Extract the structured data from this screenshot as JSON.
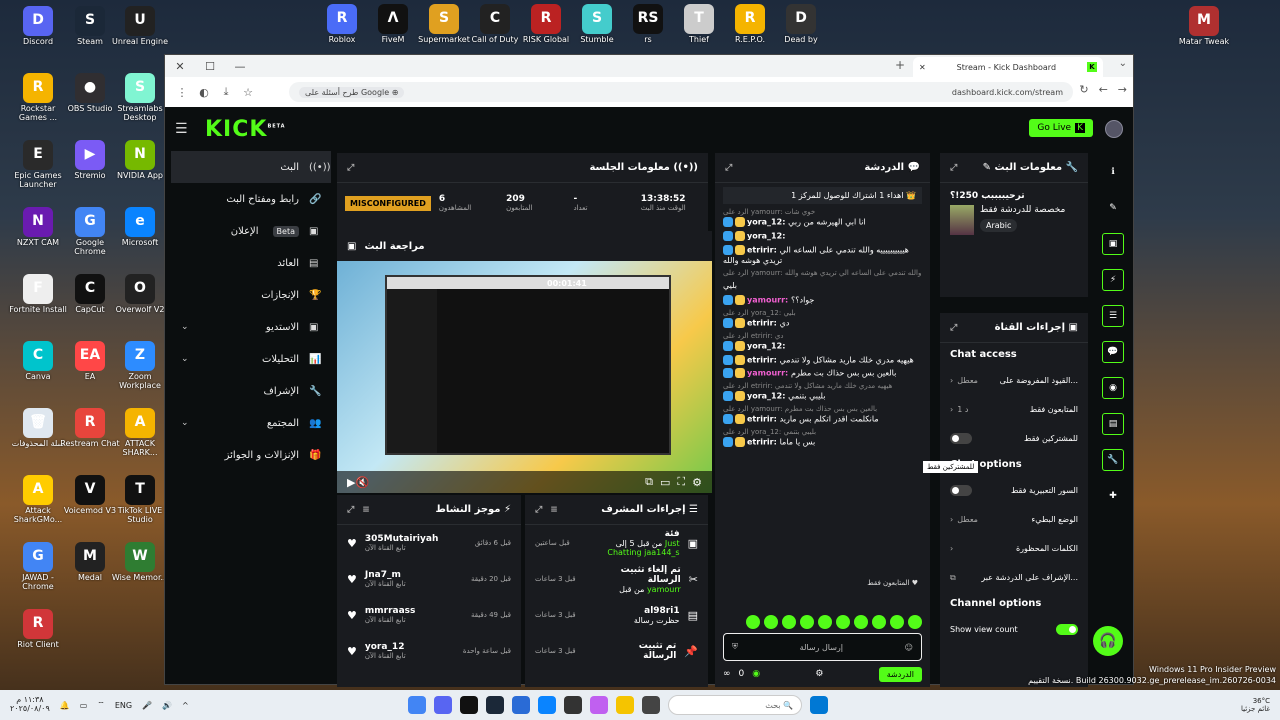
{
  "desktop_icons_left": [
    {
      "label": "Discord",
      "color": "#5865F2",
      "glyph": "D"
    },
    {
      "label": "Steam",
      "color": "#1b2838",
      "glyph": "S"
    },
    {
      "label": "Unreal Engine",
      "color": "#222",
      "glyph": "U"
    },
    {
      "label": "Rockstar Games ...",
      "color": "#f5b400",
      "glyph": "R"
    },
    {
      "label": "OBS Studio",
      "color": "#302e31",
      "glyph": "●"
    },
    {
      "label": "Streamlabs Desktop",
      "color": "#80f5d2",
      "glyph": "S"
    },
    {
      "label": "Epic Games Launcher",
      "color": "#2a2a2a",
      "glyph": "E"
    },
    {
      "label": "Stremio",
      "color": "#7b5bf5",
      "glyph": "▶"
    },
    {
      "label": "NVIDIA App",
      "color": "#76b900",
      "glyph": "N"
    },
    {
      "label": "NZXT CAM",
      "color": "#6a1bb0",
      "glyph": "N"
    },
    {
      "label": "Google Chrome",
      "color": "#4285f4",
      "glyph": "G"
    },
    {
      "label": "Microsoft",
      "color": "#0a84ff",
      "glyph": "e"
    },
    {
      "label": "Fortnite Install",
      "color": "#eee",
      "glyph": "F"
    },
    {
      "label": "CapCut",
      "color": "#111",
      "glyph": "C"
    },
    {
      "label": "Overwolf V2",
      "color": "#222",
      "glyph": "O"
    },
    {
      "label": "Canva",
      "color": "#00c4cc",
      "glyph": "C"
    },
    {
      "label": "EA",
      "color": "#ff4747",
      "glyph": "EA"
    },
    {
      "label": "Zoom Workplace",
      "color": "#2d8cff",
      "glyph": "Z"
    },
    {
      "label": "سلة المحذوفات",
      "color": "#dfe7ef",
      "glyph": "🗑"
    },
    {
      "label": "Restream Chat",
      "color": "#e8453c",
      "glyph": "R"
    },
    {
      "label": "ATTACK SHARK...",
      "color": "#f5b400",
      "glyph": "A"
    },
    {
      "label": "Attack SharkGMo...",
      "color": "#ffcc00",
      "glyph": "A"
    },
    {
      "label": "Voicemod V3",
      "color": "#111",
      "glyph": "V"
    },
    {
      "label": "TikTok LIVE Studio",
      "color": "#111",
      "glyph": "T"
    },
    {
      "label": "JAWAD - Chrome",
      "color": "#4285f4",
      "glyph": "G"
    },
    {
      "label": "Medal",
      "color": "#222",
      "glyph": "M"
    },
    {
      "label": "Wise Memor...",
      "color": "#2f7d32",
      "glyph": "W"
    },
    {
      "label": "Riot Client",
      "color": "#d13639",
      "glyph": "R"
    }
  ],
  "desktop_icons_top": [
    {
      "label": "Roblox",
      "color": "#4a6cf7",
      "glyph": "R"
    },
    {
      "label": "FiveM",
      "color": "#111",
      "glyph": "Λ"
    },
    {
      "label": "Supermarket",
      "color": "#e0a020",
      "glyph": "S"
    },
    {
      "label": "Call of Duty",
      "color": "#222",
      "glyph": "C"
    },
    {
      "label": "RISK Global",
      "color": "#b22",
      "glyph": "R"
    },
    {
      "label": "Stumble",
      "color": "#4cc",
      "glyph": "S"
    },
    {
      "label": "rs",
      "color": "#111",
      "glyph": "RS"
    },
    {
      "label": "Thief",
      "color": "#ccc",
      "glyph": "T"
    },
    {
      "label": "R.E.P.O.",
      "color": "#f5b400",
      "glyph": "R"
    },
    {
      "label": "Dead by",
      "color": "#333",
      "glyph": "D"
    }
  ],
  "desktop_icon_right": {
    "label": "Matar Tweak",
    "color": "#b03030",
    "glyph": "M"
  },
  "browser": {
    "tab_title": "Stream - Kick Dashboard",
    "omnibox_search": "طرح أسئلة على Google",
    "url": "dashboard.kick.com/stream"
  },
  "kick": {
    "logo": "KICK",
    "logo_beta": "BETA",
    "go_live": "Go Live",
    "sidebar": [
      {
        "label": "البث",
        "icon": "((•))",
        "active": true,
        "chevron": false
      },
      {
        "label": "رابط ومفتاح البث",
        "icon": "🔗",
        "active": false,
        "chevron": false
      },
      {
        "label": "الإعلان",
        "icon": "▣",
        "active": false,
        "chevron": false,
        "beta": "Beta"
      },
      {
        "label": "العائد",
        "icon": "▤",
        "active": false,
        "chevron": false
      },
      {
        "label": "الإنجازات",
        "icon": "🏆",
        "active": false,
        "chevron": false
      },
      {
        "label": "الاستديو",
        "icon": "▣",
        "active": false,
        "chevron": true
      },
      {
        "label": "التحليلات",
        "icon": "📊",
        "active": false,
        "chevron": true
      },
      {
        "label": "الإشراف",
        "icon": "🔧",
        "active": false,
        "chevron": false
      },
      {
        "label": "المجتمع",
        "icon": "👥",
        "active": false,
        "chevron": true
      },
      {
        "label": "الإنزالات و الجوائز",
        "icon": "🎁",
        "active": false,
        "chevron": false
      }
    ],
    "session": {
      "title": "معلومات الجلسة",
      "status": "MISCONFIGURED",
      "stats": [
        {
          "value": "6",
          "label": "المشاهدون"
        },
        {
          "value": "209",
          "label": "المتابعون"
        },
        {
          "value": "-",
          "label": "تعداد"
        },
        {
          "value": "13:38:52",
          "label": "الوقت منذ البث"
        }
      ]
    },
    "preview": {
      "title": "مراجعة البث",
      "time": "00:01:41"
    },
    "activity": {
      "title": "موجز النشاط",
      "items": [
        {
          "name": "305Mutairiyah",
          "sub": "تابع القناة الآن",
          "ago": "قبل 6 دقائق"
        },
        {
          "name": "Jna7_m",
          "sub": "تابع القناة الآن",
          "ago": "قبل 20 دقيقة"
        },
        {
          "name": "mmrraass",
          "sub": "تابع القناة الآن",
          "ago": "قبل 49 دقيقة"
        },
        {
          "name": "yora_12",
          "sub": "تابع القناة الآن",
          "ago": "قبل ساعة واحدة"
        }
      ]
    },
    "modactions": {
      "title": "إجراءات المشرف",
      "items": [
        {
          "title": "فئة",
          "detail": "من قبل 5 إلى",
          "highlight": "Just Chatting",
          "by": "jaa144_s",
          "ago": "قبل ساعتين"
        },
        {
          "title": "تم إلغاء تثبيت الرسالة",
          "detail": "من قبل",
          "highlight": "yamourr",
          "by": "",
          "ago": "قبل 3 ساعات"
        },
        {
          "title": "al98ri1",
          "detail": "حظرت رسالة",
          "highlight": "",
          "by": "",
          "ago": "قبل 3 ساعات"
        },
        {
          "title": "تم تثبيت الرسالة",
          "detail": "",
          "highlight": "",
          "by": "",
          "ago": "قبل 3 ساعات"
        }
      ]
    },
    "chat": {
      "title": "الدردشة",
      "pinned": "اهداء 1 اشتراك للوصول للمركز 1",
      "messages": [
        {
          "reply": "الرد على yamourr: خوي شات",
          "user": "yora_12",
          "text": "انا ابي الهيرشه من ربي",
          "pink": false
        },
        {
          "reply": "",
          "user": "yora_12",
          "text": "",
          "pink": false
        },
        {
          "reply": "",
          "user": "etririr",
          "text": "هييييييييييه والله تندمي على الساعه الي تريدي هوشه والله",
          "pink": false
        },
        {
          "reply": "الرد على yamourr: والله تندمي على الساعه الي تريدي هوشه والله",
          "user": "",
          "text": "",
          "pink": false
        },
        {
          "reply": "",
          "user": "",
          "text": "بليي",
          "pink": false
        },
        {
          "reply": "",
          "user": "yamourr",
          "text": "جواد؟؟",
          "pink": true
        },
        {
          "reply": "الرد على yora_12: بليي",
          "user": "etririr",
          "text": "دي",
          "pink": false
        },
        {
          "reply": "الرد على etririr: دي",
          "user": "yora_12",
          "text": "",
          "pink": false
        },
        {
          "reply": "",
          "user": "etririr",
          "text": "هيهيه مدري خلك ماريد مشاكل ولا تندمي",
          "pink": false
        },
        {
          "reply": "",
          "user": "yamourr",
          "text": "بالعين بس بس حذاك بت مطرم",
          "pink": true
        },
        {
          "reply": "الرد على etririr: هيهيه مدري خلك ماريد مشاكل ولا تندمي",
          "user": "yora_12",
          "text": "بليبي بتنمي",
          "pink": false
        },
        {
          "reply": "الرد على yamourr: بالعين بس بس حذاك بت مطرم",
          "user": "etririr",
          "text": "مانكلمت اقدر اتكلم بس ماريد",
          "pink": false
        },
        {
          "reply": "الرد على yora_12: بليبي بتنمي",
          "user": "etririr",
          "text": "بس يا ماما",
          "pink": false
        }
      ],
      "followers_only": "المتابعون فقط",
      "placeholder": "إرسال رسالة",
      "points": "0",
      "send": "الدردشة"
    },
    "info": {
      "title": "معلومات البث",
      "stream_title": "ترحيببببب 250!؟",
      "category": "مخصصة للدردشة فقط",
      "language": "Arabic"
    },
    "actions": {
      "title": "إجراءات القناة",
      "chat_access": "Chat access",
      "rows_access": [
        {
          "label": "القيود المفروضة على...",
          "value": "معطل",
          "type": "chevron"
        },
        {
          "label": "المتابعون فقط",
          "value": "1 د",
          "type": "chevron"
        },
        {
          "label": "للمشتركين فقط",
          "value": "",
          "type": "toggle"
        }
      ],
      "tooltip": "للمشتركين فقط",
      "chat_options": "Chat options",
      "rows_options": [
        {
          "label": "السور التعبيرية فقط",
          "value": "",
          "type": "toggle"
        },
        {
          "label": "الوضع البطيء",
          "value": "معطل",
          "type": "chevron"
        },
        {
          "label": "الكلمات المحظورة",
          "value": "",
          "type": "chevron"
        },
        {
          "label": "الإشراف على الدردشة عبر...",
          "value": "",
          "type": "external"
        }
      ],
      "channel_options": "Channel options",
      "show_view_count": "Show view count"
    }
  },
  "taskbar": {
    "search": "بحث",
    "lang": "ENG",
    "time": "١١:٣٨ م",
    "date": "٢٠٢٥/٠٨/٠٩",
    "weather": "36°C",
    "weather_desc": "غائم جزئيا"
  },
  "watermark": {
    "line1": "Windows 11 Pro Insider Preview",
    "line2": "نسخة التقييم. Build 26300.9032.ge_prerelease_im.260726-0034"
  }
}
